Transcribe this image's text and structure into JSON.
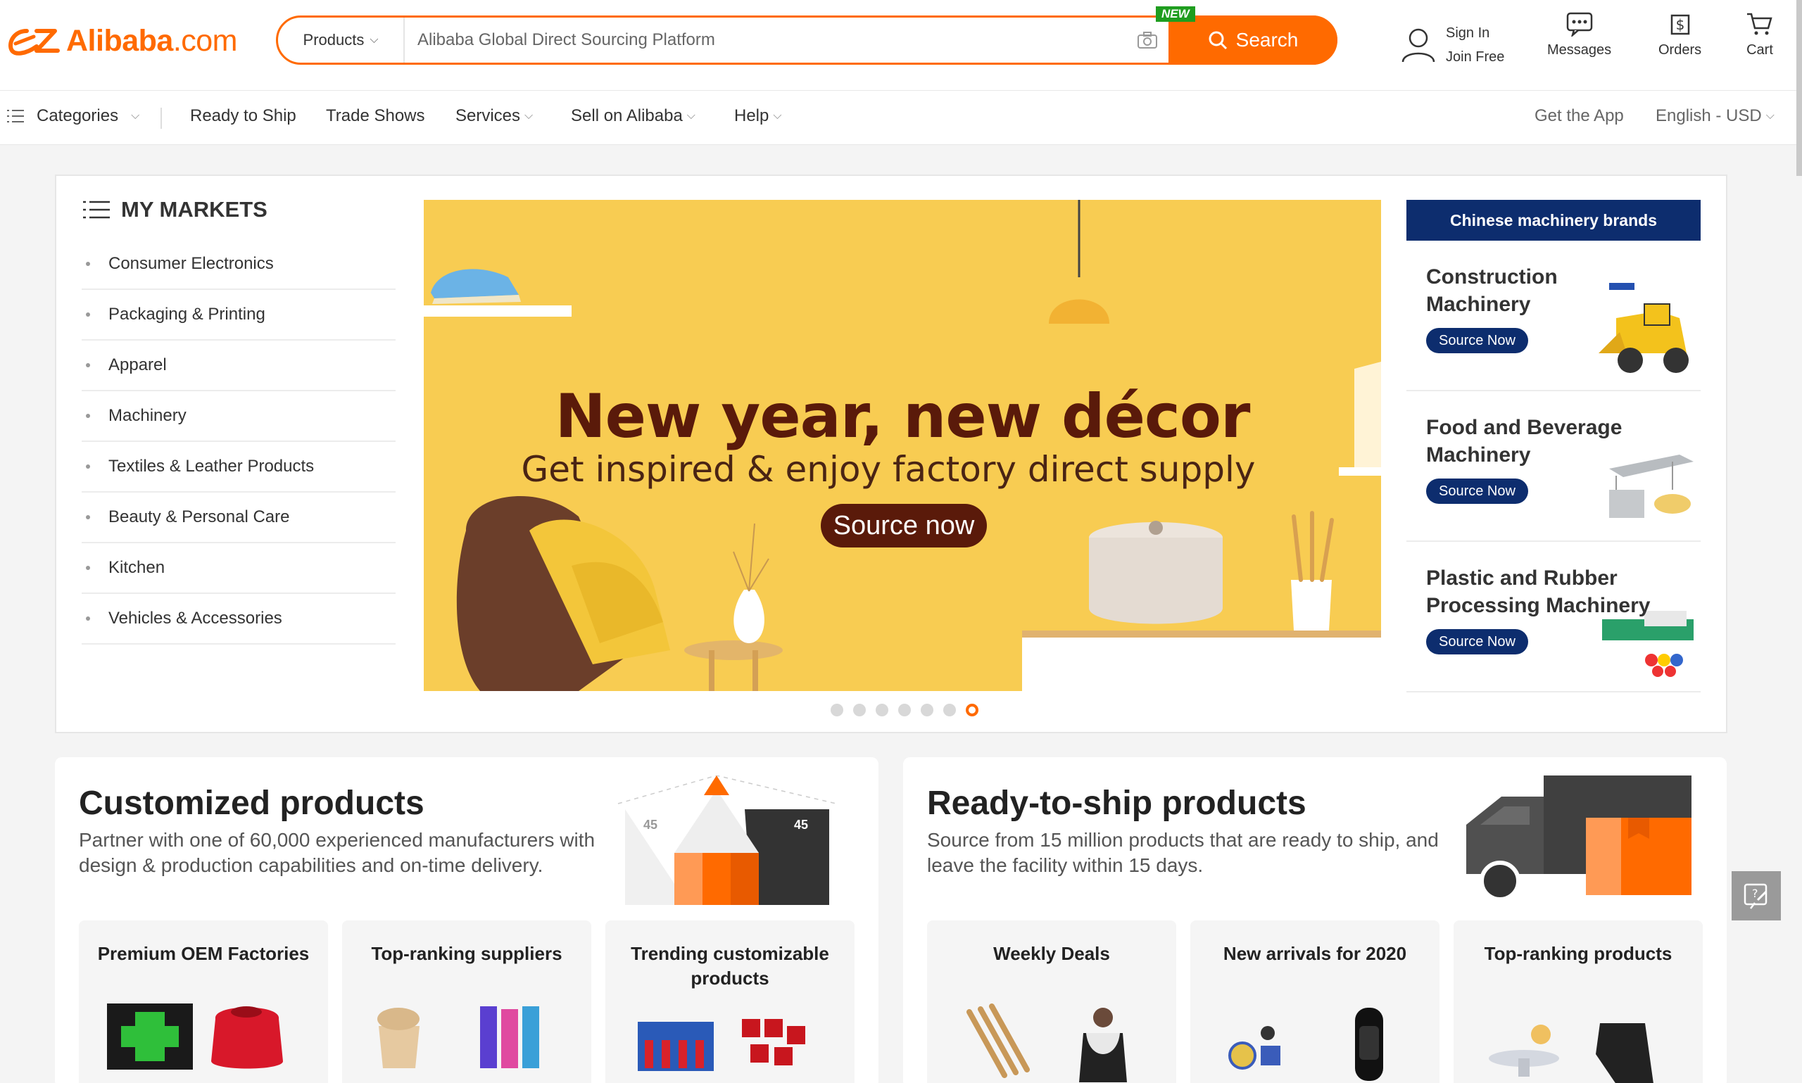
{
  "header": {
    "brand": "Alibaba",
    "brand_suffix": ".com",
    "search": {
      "category": "Products",
      "placeholder": "Alibaba Global Direct Sourcing Platform",
      "badge": "NEW",
      "button": "Search"
    },
    "sign_in": "Sign In",
    "join_free": "Join Free",
    "messages": "Messages",
    "orders": "Orders",
    "cart": "Cart"
  },
  "nav": {
    "categories": "Categories",
    "ready_to_ship": "Ready to Ship",
    "trade_shows": "Trade Shows",
    "services": "Services",
    "sell": "Sell on Alibaba",
    "help": "Help",
    "get_app": "Get the App",
    "language": "English - USD"
  },
  "markets": {
    "title": "MY MARKETS",
    "items": [
      "Consumer Electronics",
      "Packaging & Printing",
      "Apparel",
      "Machinery",
      "Textiles & Leather Products",
      "Beauty & Personal Care",
      "Kitchen",
      "Vehicles & Accessories"
    ]
  },
  "banner": {
    "headline": "New year, new décor",
    "subline": "Get inspired & enjoy factory direct supply",
    "cta": "Source now",
    "slide_count": 7,
    "active_slide": 7
  },
  "brands": {
    "title": "Chinese machinery brands",
    "cards": [
      {
        "name": "Construction Machinery",
        "cta": "Source Now"
      },
      {
        "name": "Food and Beverage Machinery",
        "cta": "Source Now"
      },
      {
        "name": "Plastic and Rubber Processing Machinery",
        "cta": "Source Now"
      }
    ]
  },
  "customized": {
    "title": "Customized products",
    "desc": "Partner with one of 60,000 experienced manufacturers with design & production capabilities and on-time delivery.",
    "angle_left": "45",
    "angle_right": "45",
    "cards": [
      "Premium OEM Factories",
      "Top-ranking suppliers",
      "Trending customizable products"
    ]
  },
  "ready": {
    "title": "Ready-to-ship products",
    "desc": "Source from 15 million products that are ready to ship, and leave the facility within 15 days.",
    "cards": [
      "Weekly Deals",
      "New arrivals for 2020",
      "Top-ranking products"
    ]
  },
  "colors": {
    "accent": "#ff6a00",
    "navy": "#0d2d6e",
    "banner_bg": "#f8cc52",
    "badge_green": "#1f9d1f"
  }
}
